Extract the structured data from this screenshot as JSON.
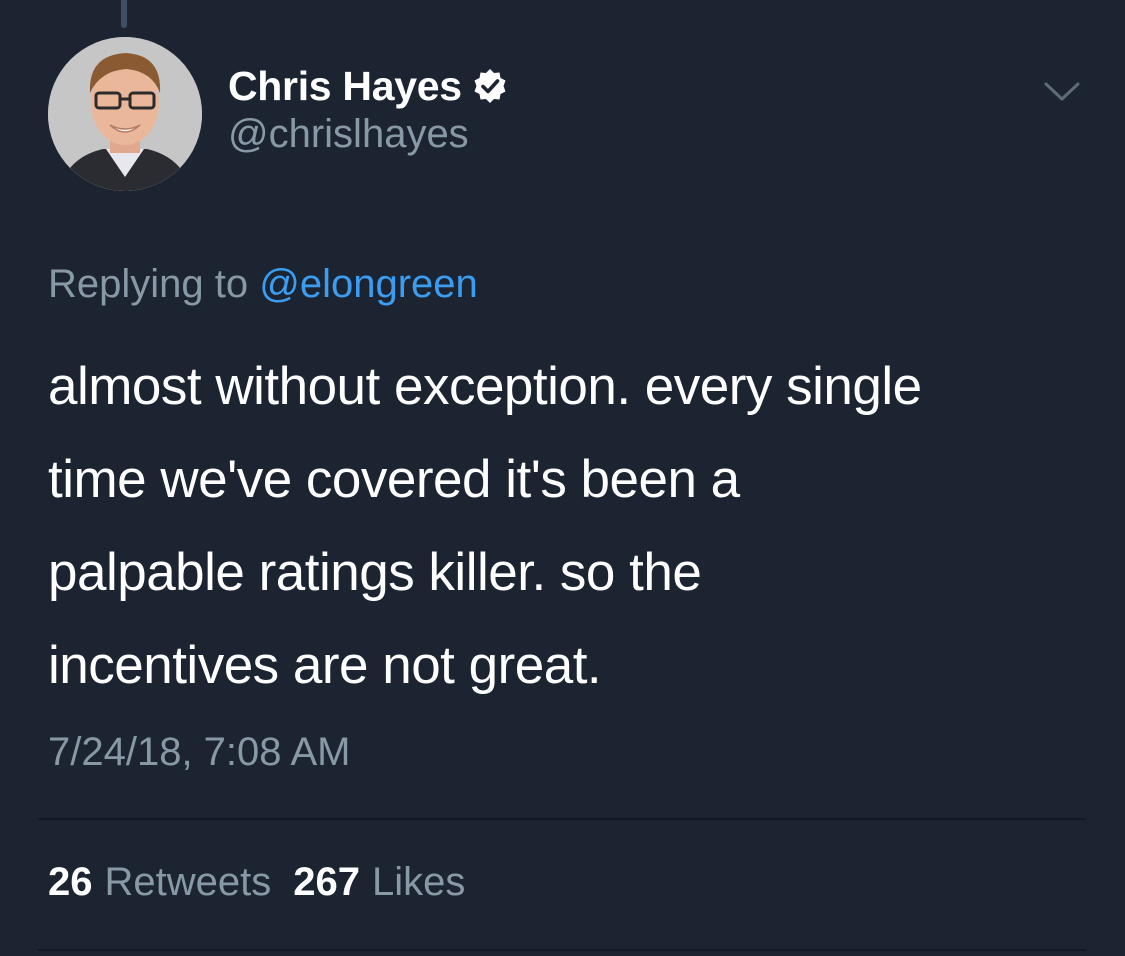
{
  "author": {
    "display_name": "Chris Hayes",
    "handle": "@chrislhayes",
    "verified": true
  },
  "icons": {
    "verified": "verified-badge-icon",
    "more": "chevron-down-icon"
  },
  "reply": {
    "prefix": "Replying to",
    "mention": "@elongreen"
  },
  "tweet": {
    "lines": [
      "almost without exception. every single",
      "time we've covered it's been a",
      "palpable ratings killer. so the",
      "incentives are not great."
    ],
    "timestamp": "7/24/18, 7:08 AM"
  },
  "stats": {
    "retweets_count": "26",
    "retweets_label": "Retweets",
    "likes_count": "267",
    "likes_label": "Likes"
  },
  "colors": {
    "background": "#1c2431",
    "secondary_text": "#8899a6",
    "link": "#3a9df2",
    "primary_text": "#ffffff"
  }
}
